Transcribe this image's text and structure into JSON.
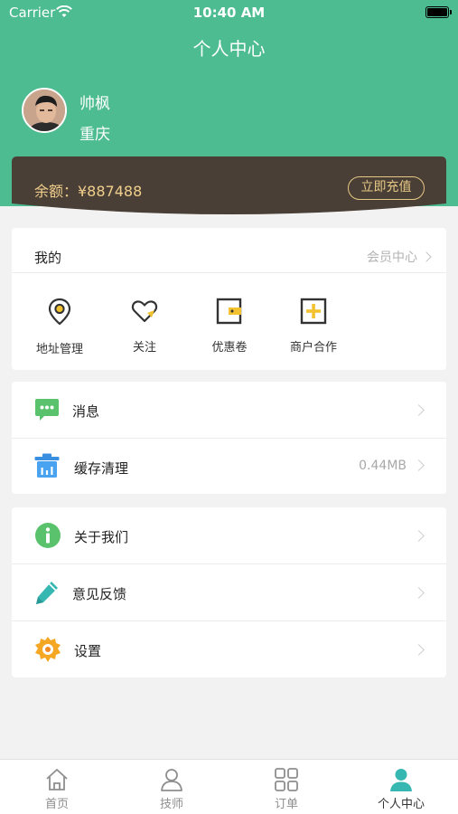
{
  "status_bar": {
    "carrier": "Carrier",
    "time": "10:40 AM"
  },
  "header": {
    "title": "个人中心"
  },
  "user": {
    "name": "帅枫",
    "city": "重庆"
  },
  "balance": {
    "text": "余额：¥887488",
    "recharge_label": "立即充值"
  },
  "mine": {
    "title": "我的",
    "member_center": "会员中心",
    "items": [
      {
        "label": "地址管理",
        "icon": "location-icon"
      },
      {
        "label": "关注",
        "icon": "heart-icon"
      },
      {
        "label": "优惠卷",
        "icon": "wallet-icon"
      },
      {
        "label": "商户合作",
        "icon": "plus-box-icon"
      }
    ]
  },
  "list1": [
    {
      "label": "消息",
      "value": "",
      "icon": "message-icon"
    },
    {
      "label": "缓存清理",
      "value": "0.44MB",
      "icon": "trash-icon"
    }
  ],
  "list2": [
    {
      "label": "关于我们",
      "icon": "info-icon"
    },
    {
      "label": "意见反馈",
      "icon": "pencil-icon"
    },
    {
      "label": "设置",
      "icon": "gear-icon"
    }
  ],
  "tabs": [
    {
      "label": "首页",
      "icon": "home-icon"
    },
    {
      "label": "技师",
      "icon": "user-icon"
    },
    {
      "label": "订单",
      "icon": "grid-icon"
    },
    {
      "label": "个人中心",
      "icon": "profile-icon"
    }
  ],
  "colors": {
    "primary": "#4dbc91",
    "balance_bg": "#4a3f36",
    "gold": "#e5c884"
  }
}
